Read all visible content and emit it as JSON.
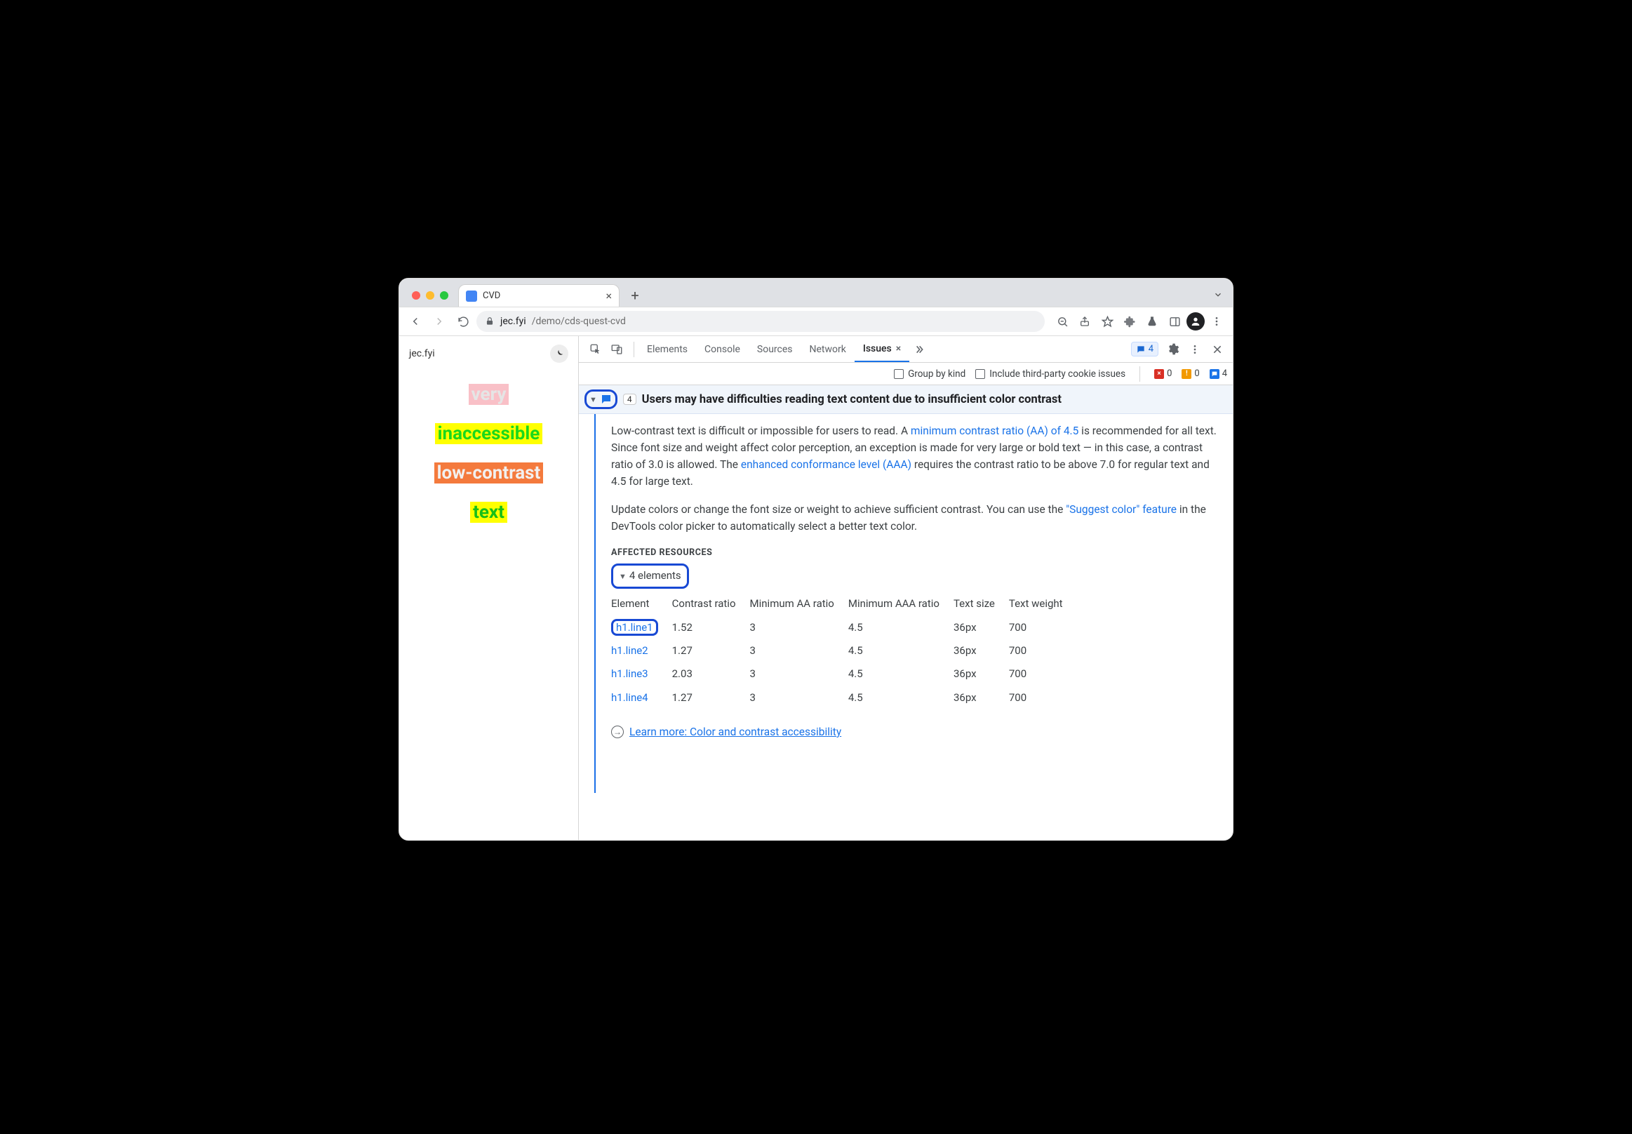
{
  "window": {
    "tab_title": "CVD",
    "url_host": "jec.fyi",
    "url_path": "/demo/cds-quest-cvd"
  },
  "page": {
    "site_title": "jec.fyi",
    "samples": {
      "s1": "very",
      "s2": "inaccessible",
      "s3": "low-contrast",
      "s4": "text"
    }
  },
  "devtools": {
    "tabs": {
      "elements": "Elements",
      "console": "Console",
      "sources": "Sources",
      "network": "Network",
      "issues": "Issues"
    },
    "issues_badge": "4",
    "options": {
      "group_by_kind": "Group by kind",
      "include_third_party": "Include third-party cookie issues"
    },
    "status": {
      "red": "0",
      "amber": "0",
      "blue": "4"
    }
  },
  "issue": {
    "count": "4",
    "title": "Users may have difficulties reading text content due to insufficient color contrast",
    "p1a": "Low-contrast text is difficult or impossible for users to read. A ",
    "p1_link1": "minimum contrast ratio (AA) of 4.5",
    "p1b": " is recommended for all text. Since font size and weight affect color perception, an exception is made for very large or bold text — in this case, a contrast ratio of 3.0 is allowed. The ",
    "p1_link2": "enhanced conformance level (AAA)",
    "p1c": " requires the contrast ratio to be above 7.0 for regular text and 4.5 for large text.",
    "p2a": "Update colors or change the font size or weight to achieve sufficient contrast. You can use the ",
    "p2_link": "\"Suggest color\" feature",
    "p2b": " in the DevTools color picker to automatically select a better text color.",
    "affected_heading": "AFFECTED RESOURCES",
    "elements_label": "4 elements",
    "table": {
      "headers": {
        "element": "Element",
        "contrast": "Contrast ratio",
        "aa": "Minimum AA ratio",
        "aaa": "Minimum AAA ratio",
        "size": "Text size",
        "weight": "Text weight"
      },
      "rows": [
        {
          "element": "h1.line1",
          "contrast": "1.52",
          "aa": "3",
          "aaa": "4.5",
          "size": "36px",
          "weight": "700"
        },
        {
          "element": "h1.line2",
          "contrast": "1.27",
          "aa": "3",
          "aaa": "4.5",
          "size": "36px",
          "weight": "700"
        },
        {
          "element": "h1.line3",
          "contrast": "2.03",
          "aa": "3",
          "aaa": "4.5",
          "size": "36px",
          "weight": "700"
        },
        {
          "element": "h1.line4",
          "contrast": "1.27",
          "aa": "3",
          "aaa": "4.5",
          "size": "36px",
          "weight": "700"
        }
      ]
    },
    "learn_more": "Learn more: Color and contrast accessibility"
  }
}
